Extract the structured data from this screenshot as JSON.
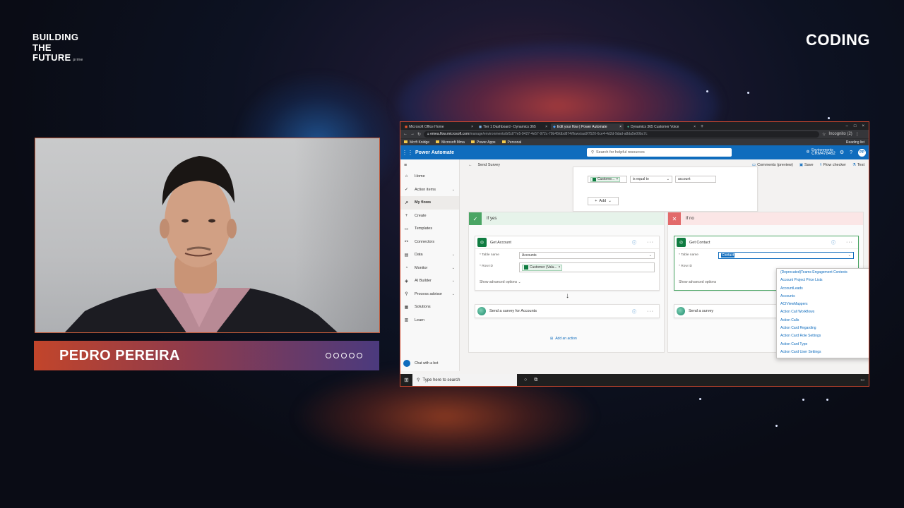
{
  "brand": {
    "line1": "BUILDING",
    "line2": "THE",
    "line3": "FUTURE",
    "sub": "prime"
  },
  "section": "CODING",
  "speaker": {
    "name": "PEDRO PEREIRA"
  },
  "browser": {
    "tabs": [
      "Microsoft Office Home",
      "Tier 1 Dashboard - Dynamics 365",
      "Edit your flow | Power Automate",
      "Dynamics 365 Customer Voice"
    ],
    "active_tab_index": 2,
    "url_domain": "emea.flow.microsoft.com",
    "url_path": "/manage/environments/bf1d77e5-9427-4e57-972c-79b45fdbd874/flows/aa9f7520-6ce4-4d2d-9dad-a8da5e00bc7c",
    "profile": "Incognito (2)",
    "bookmarks": [
      "Mcrft Knidge",
      "Microsoft Mma",
      "Power Apps",
      "Personal"
    ],
    "reading_list": "Reading list"
  },
  "app": {
    "name": "Power Automate",
    "search_placeholder": "Search for helpful resources",
    "env_label": "Environments",
    "env_name": "CRM478462",
    "avatar_initials": "PP"
  },
  "nav": {
    "items": [
      {
        "label": "Home",
        "icon": "home-icon",
        "glyph": "⌂",
        "chevron": false
      },
      {
        "label": "Action items",
        "icon": "check-icon",
        "glyph": "✓",
        "chevron": true
      },
      {
        "label": "My flows",
        "icon": "flow-icon",
        "glyph": "↗",
        "chevron": false,
        "selected": true
      },
      {
        "label": "Create",
        "icon": "plus-icon",
        "glyph": "+",
        "chevron": false
      },
      {
        "label": "Templates",
        "icon": "template-icon",
        "glyph": "▭",
        "chevron": false
      },
      {
        "label": "Connectors",
        "icon": "connector-icon",
        "glyph": "⚯",
        "chevron": false
      },
      {
        "label": "Data",
        "icon": "data-icon",
        "glyph": "▤",
        "chevron": true
      },
      {
        "label": "Monitor",
        "icon": "monitor-icon",
        "glyph": "◔",
        "chevron": true
      },
      {
        "label": "AI Builder",
        "icon": "ai-icon",
        "glyph": "◈",
        "chevron": true
      },
      {
        "label": "Process advisor",
        "icon": "process-icon",
        "glyph": "⚲",
        "chevron": true
      },
      {
        "label": "Solutions",
        "icon": "solutions-icon",
        "glyph": "▦",
        "chevron": false
      },
      {
        "label": "Learn",
        "icon": "book-icon",
        "glyph": "▥",
        "chevron": false
      }
    ],
    "chat_bot": "Chat with a bot"
  },
  "cmdbar": {
    "flow_name": "Send Survey",
    "comments": "Comments (preview)",
    "save": "Save",
    "flow_checker": "Flow checker",
    "test": "Test"
  },
  "condition": {
    "token": "Custome...",
    "operator": "is equal to",
    "value": "account",
    "add_label": "Add"
  },
  "branch_yes": {
    "title": "If yes",
    "get_action": "Get Account",
    "table_label": "* Table name",
    "table_value": "Accounts",
    "row_label": "* Row ID",
    "row_token": "Customer (Valu...",
    "advanced": "Show advanced options",
    "survey_action": "Send a survey for Accounts",
    "add_action": "Add an action"
  },
  "branch_no": {
    "title": "If no",
    "get_action": "Get Contact",
    "table_label": "* Table name",
    "table_value": "Contact",
    "row_label": "* Row ID",
    "advanced": "Show advanced options",
    "survey_action": "Send a survey"
  },
  "dropdown_options": [
    "(Deprecated)Teams Engagement Contexts",
    "Account Project Price Lists",
    "AccountLeads",
    "Accounts",
    "ACIViewMappers",
    "Action Call Workflows",
    "Action Calls",
    "Action Card Regarding",
    "Action Card Role Settings",
    "Action Card Type",
    "Action Card User Settings"
  ],
  "taskbar": {
    "search_placeholder": "Type here to search"
  }
}
